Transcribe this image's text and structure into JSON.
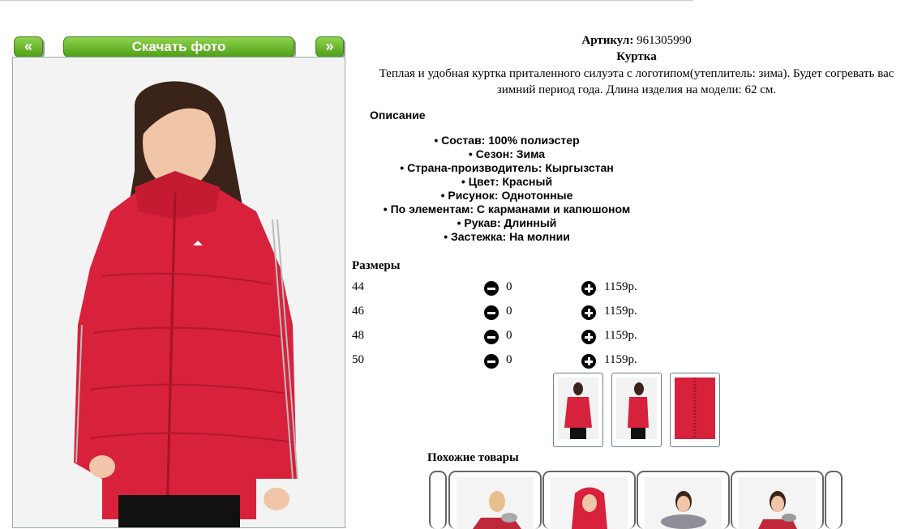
{
  "gallery": {
    "prev_label": "«",
    "next_label": "»",
    "download_label": "Скачать фото"
  },
  "product": {
    "article_label": "Артикул:",
    "article_value": "961305990",
    "title": "Куртка",
    "description": "Теплая и удобная куртка приталенного силуэта с логотипом(утеплитель: зима). Будет согревать вас зимний период года. Длина изделия на модели: 62 см."
  },
  "specs": {
    "heading": "Описание",
    "items": [
      "Состав: 100% полиэстер",
      "Сезон: Зима",
      "Страна-производитель: Кыргызстан",
      "Цвет: Красный",
      "Рисунок: Однотонные",
      "По элементам: С карманами и капюшоном",
      "Рукав: Длинный",
      "Застежка: На молнии"
    ]
  },
  "sizes": {
    "heading": "Размеры",
    "rows": [
      {
        "size": "44",
        "qty": "0",
        "price": "1159р."
      },
      {
        "size": "46",
        "qty": "0",
        "price": "1159р."
      },
      {
        "size": "48",
        "qty": "0",
        "price": "1159р."
      },
      {
        "size": "50",
        "qty": "0",
        "price": "1159р."
      }
    ]
  },
  "similar": {
    "heading": "Похожие товары"
  },
  "icons": {
    "minus": "minus-circle-icon",
    "plus": "plus-circle-icon"
  },
  "colors": {
    "button_green": "#5aa91f",
    "jacket_red": "#d8213b"
  }
}
